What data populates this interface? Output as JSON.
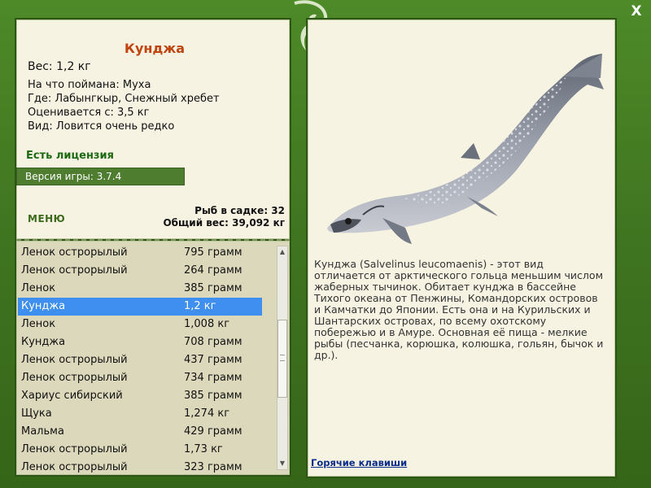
{
  "window": {
    "close_label": "X"
  },
  "catch": {
    "title": "Кунджа",
    "weight_line": "Вес: 1,2 кг",
    "bait_line": "На что поймана: Муха",
    "where_line": "Где: Лабынгкыр, Снежный хребет",
    "value_line": "Оценивается с: 3,5 кг",
    "kind_line": "Вид: Ловится очень редко"
  },
  "license_label": "Есть лицензия",
  "version_label": "Версия игры: 3.7.4",
  "menu_label": "МЕНЮ",
  "stats": {
    "fish_count_line": "Рыб в садке: 32",
    "total_weight_line": "Общий вес: 39,092 кг"
  },
  "fish_list": [
    {
      "name": "Ленок острорылый",
      "weight": "795 грамм"
    },
    {
      "name": "Ленок острорылый",
      "weight": "264 грамм"
    },
    {
      "name": "Ленок",
      "weight": "385 грамм"
    },
    {
      "name": "Кунджа",
      "weight": "1,2 кг",
      "selected": true
    },
    {
      "name": "Ленок",
      "weight": "1,008 кг"
    },
    {
      "name": "Кунджа",
      "weight": "708 грамм"
    },
    {
      "name": "Ленок острорылый",
      "weight": "437 грамм"
    },
    {
      "name": "Ленок острорылый",
      "weight": "734 грамм"
    },
    {
      "name": "Хариус сибирский",
      "weight": "385 грамм"
    },
    {
      "name": "Щука",
      "weight": "1,274 кг"
    },
    {
      "name": "Мальма",
      "weight": "429 грамм"
    },
    {
      "name": "Ленок острорылый",
      "weight": "1,73 кг"
    },
    {
      "name": "Ленок острорылый",
      "weight": "323 грамм"
    }
  ],
  "description": "Кунджа (Salvelinus leucomaenis) - этот вид отличается от арктического гольца меньшим числом жаберных тычинок. Обитает кунджа в бассейне Тихого океана от Пенжины, Командорских островов и Камчатки до Японии. Есть она и на Курильских и Шантарских островах, по всему охотскому побережью и в Амуре. Основная её пища - мелкие рыбы (песчанка, корюшка, колюшка, гольян, бычок и др.).",
  "hotkeys_label": "Горячие клавиши",
  "colors": {
    "accent": "#c0440f",
    "frame": "#3f7420",
    "selection": "#3f8ff0",
    "license": "#1e6a14"
  }
}
